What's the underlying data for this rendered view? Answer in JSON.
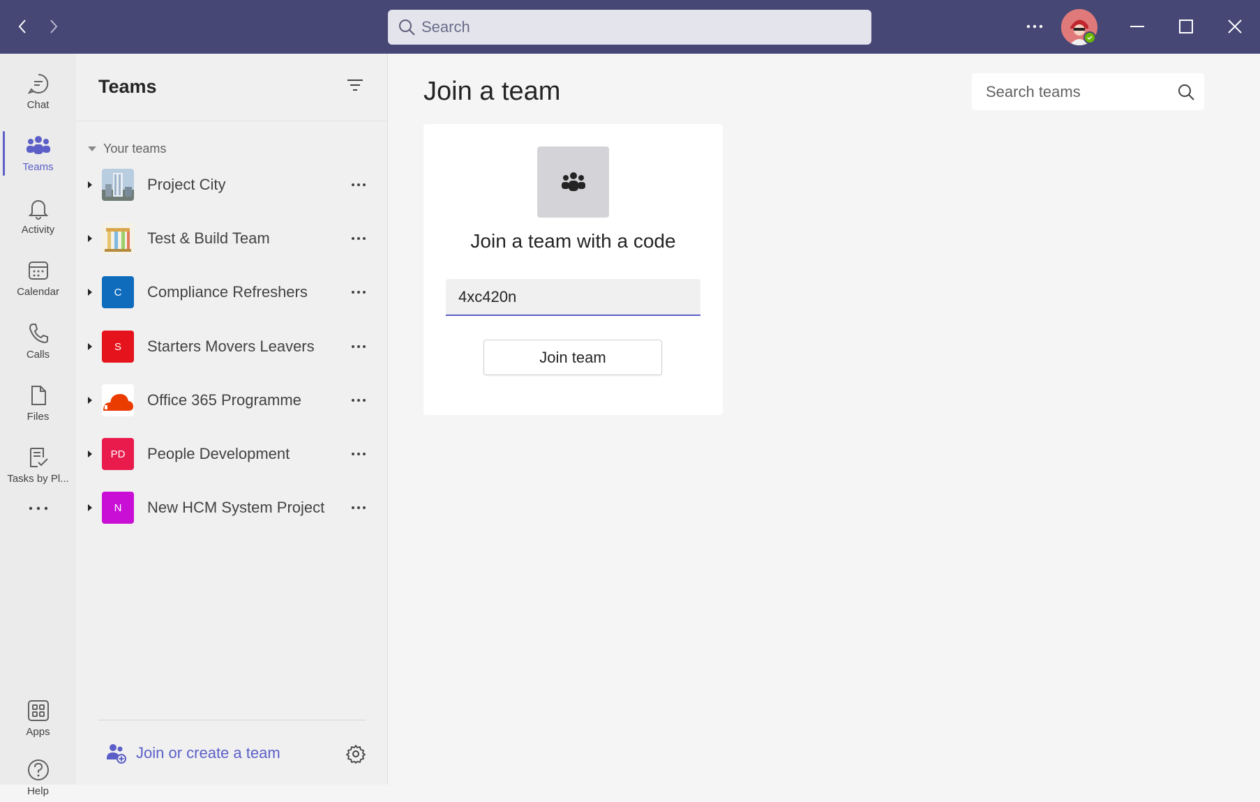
{
  "titlebar": {
    "search_placeholder": "Search",
    "back_icon": "chevron-left-icon",
    "forward_icon": "chevron-right-icon",
    "more_icon": "more-horizontal-icon",
    "minimize_icon": "minimize-icon",
    "maximize_icon": "maximize-icon",
    "close_icon": "close-icon"
  },
  "rail": {
    "items": [
      {
        "label": "Chat",
        "icon": "chat-icon"
      },
      {
        "label": "Teams",
        "icon": "teams-icon",
        "active": true
      },
      {
        "label": "Activity",
        "icon": "bell-icon"
      },
      {
        "label": "Calendar",
        "icon": "calendar-icon"
      },
      {
        "label": "Calls",
        "icon": "phone-icon"
      },
      {
        "label": "Files",
        "icon": "file-icon"
      },
      {
        "label": "Tasks by Pl...",
        "icon": "tasks-icon"
      }
    ],
    "apps_label": "Apps",
    "help_label": "Help"
  },
  "panel": {
    "title": "Teams",
    "section_label": "Your teams",
    "teams": [
      {
        "name": "Project City",
        "initials": "",
        "color": "#7a9cc0"
      },
      {
        "name": "Test & Build Team",
        "initials": "",
        "color": "#e9d6a8"
      },
      {
        "name": "Compliance Refreshers",
        "initials": "C",
        "color": "#0f6cbd"
      },
      {
        "name": "Starters Movers Leavers",
        "initials": "S",
        "color": "#e5131b"
      },
      {
        "name": "Office 365 Programme",
        "initials": "",
        "color": "#eb3c00"
      },
      {
        "name": "People Development",
        "initials": "PD",
        "color": "#e81b4c"
      },
      {
        "name": "New HCM System Project",
        "initials": "N",
        "color": "#c90fd6"
      }
    ],
    "join_create_label": "Join or create a team"
  },
  "main": {
    "title": "Join a team",
    "search_teams_placeholder": "Search teams",
    "card": {
      "heading": "Join a team with a code",
      "code_value": "4xc420n",
      "join_button": "Join team"
    }
  },
  "colors": {
    "titlebar": "#464775",
    "accent": "#5b5fc7"
  }
}
